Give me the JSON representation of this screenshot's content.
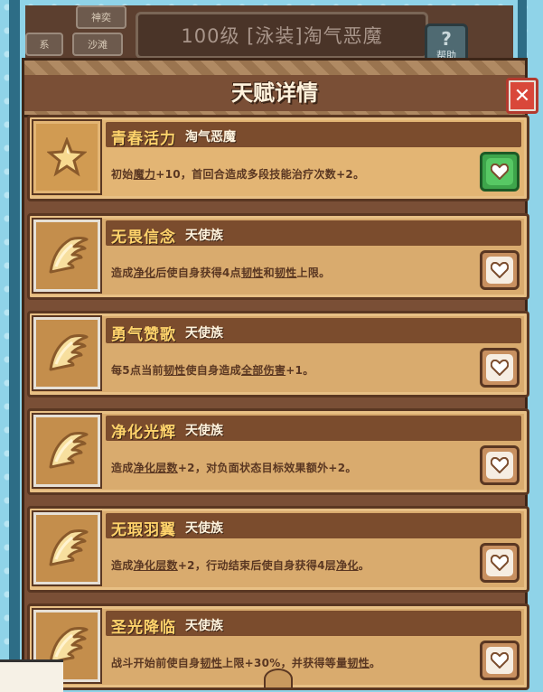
{
  "header": {
    "tabs": [
      "神奕",
      "系",
      "沙滩"
    ],
    "level_title": "100级 [泳装]淘气恶魔",
    "help_label": "帮助",
    "help_glyph": "?"
  },
  "panel": {
    "title": "天赋详情",
    "close_glyph": "✕"
  },
  "talents": [
    {
      "name": "青春活力",
      "tribe": "淘气恶魔",
      "desc": "初始魔力+10，首回合造成多段技能治疗次数+2。",
      "icon": "star-icon",
      "active": true
    },
    {
      "name": "无畏信念",
      "tribe": "天使族",
      "desc": "造成净化后使自身获得4点韧性和韧性上限。",
      "icon": "wing-icon",
      "active": false
    },
    {
      "name": "勇气赞歌",
      "tribe": "天使族",
      "desc": "每5点当前韧性使自身造成全部伤害+1。",
      "icon": "wing-icon",
      "active": false
    },
    {
      "name": "净化光辉",
      "tribe": "天使族",
      "desc": "造成净化层数+2，对负面状态目标效果额外+2。",
      "icon": "wing-icon",
      "active": false
    },
    {
      "name": "无瑕羽翼",
      "tribe": "天使族",
      "desc": "造成净化层数+2，行动结束后使自身获得4层净化。",
      "icon": "wing-icon",
      "active": false
    },
    {
      "name": "圣光降临",
      "tribe": "天使族",
      "desc": "战斗开始前使自身韧性上限+30%，并获得等量韧性。",
      "icon": "wing-icon",
      "active": false
    }
  ],
  "colors": {
    "accent_gold": "#ffd36b",
    "card_bg": "#d9ab6e",
    "active_heart": "#3ea54b"
  }
}
